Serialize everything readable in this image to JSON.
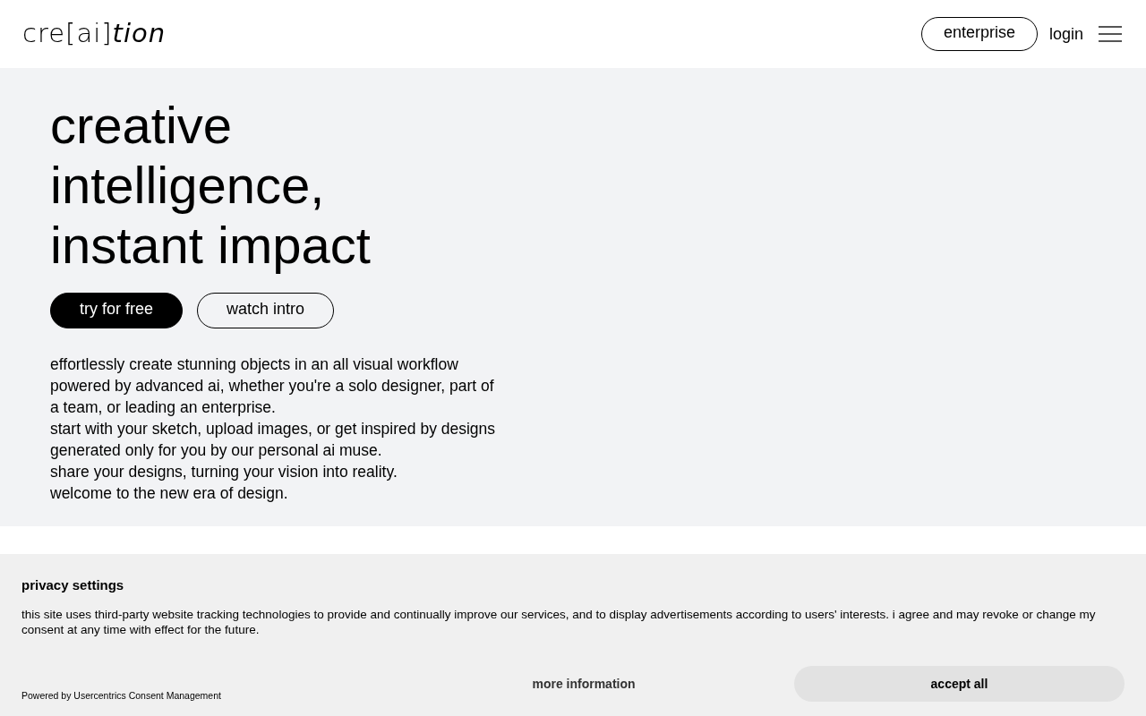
{
  "header": {
    "logo": "cre[ai]*tion*",
    "enterprise_button": "enterprise",
    "login_link": "login"
  },
  "hero": {
    "headline": [
      "creative",
      "intelligence,",
      "instant impact"
    ],
    "buttons": [
      {
        "label": "try for free",
        "kind": "primary"
      },
      {
        "label": "watch intro",
        "kind": "outline"
      }
    ],
    "paragraphs": [
      "effortlessly create stunning objects in an all visual workflow powered by advanced ai, whether you're a solo designer, part of a team, or leading an enterprise.",
      "start with your sketch, upload images, or get inspired by designs generated only for you by our personal ai muse.",
      "share your designs, turning your vision into reality.",
      "welcome to the new era of design."
    ]
  },
  "privacy_banner": {
    "title": "privacy settings",
    "text": "this site uses third-party website tracking technologies to provide and continually improve our services, and to display advertisements according to users' interests. i agree and may revoke or change my consent at any time with effect for the future.",
    "powered_by": "Powered by Usercentrics Consent Management",
    "more_info": "more information",
    "accept": "accept all"
  }
}
